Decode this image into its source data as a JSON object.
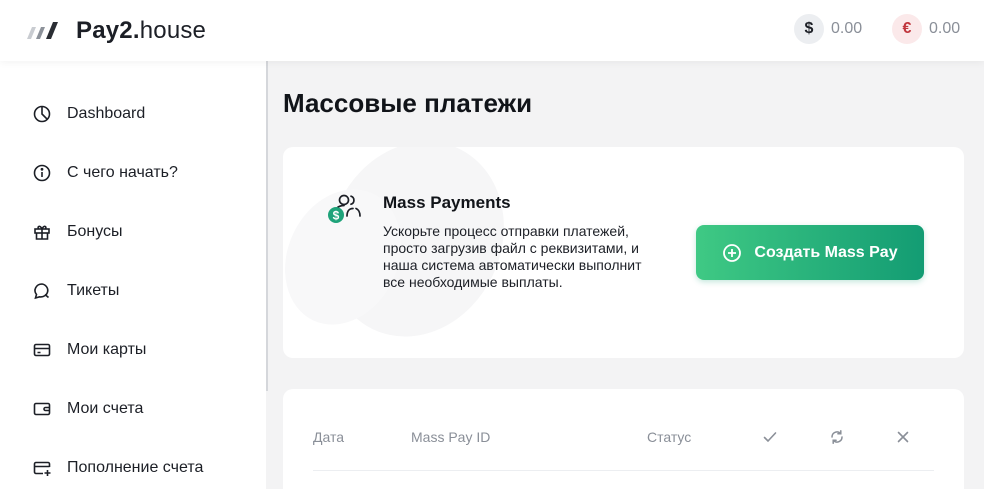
{
  "header": {
    "brand_bold": "Pay2.",
    "brand_light": "house",
    "balances": [
      {
        "symbol": "$",
        "amount": "0.00"
      },
      {
        "symbol": "€",
        "amount": "0.00"
      }
    ]
  },
  "sidebar": {
    "items": [
      {
        "label": "Dashboard"
      },
      {
        "label": "С чего начать?"
      },
      {
        "label": "Бонусы"
      },
      {
        "label": "Тикеты"
      },
      {
        "label": "Мои карты"
      },
      {
        "label": "Мои счета"
      },
      {
        "label": "Пополнение счета"
      }
    ]
  },
  "main": {
    "title": "Массовые платежи",
    "promo": {
      "icon_symbol": "$",
      "title": "Mass Payments",
      "description": "Ускорьте процесс отправки платежей, просто загрузив файл с реквизитами, и наша система автоматически выполнит все необходимые выплаты.",
      "button_label": "Создать Mass Pay"
    },
    "table": {
      "columns": [
        "Дата",
        "Mass Pay ID",
        "Статус"
      ],
      "icon_columns": [
        "check-icon",
        "refresh-icon",
        "close-icon"
      ]
    }
  },
  "colors": {
    "accent_start": "#3fc984",
    "accent_end": "#139c73",
    "euro": "#c0363d"
  }
}
